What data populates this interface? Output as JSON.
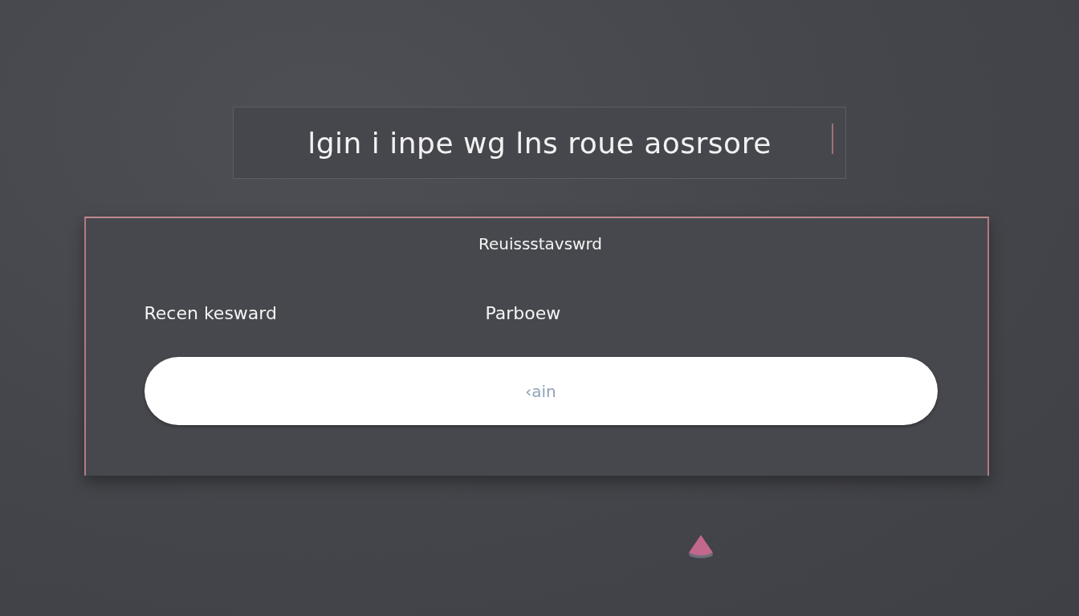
{
  "title_field": {
    "value": "lgin i inpe wg lns roue aosrsore"
  },
  "card": {
    "heading": "Reuissstavswrd",
    "labels": [
      "Recen kesward",
      "Parboew"
    ],
    "button": "‹ain"
  }
}
